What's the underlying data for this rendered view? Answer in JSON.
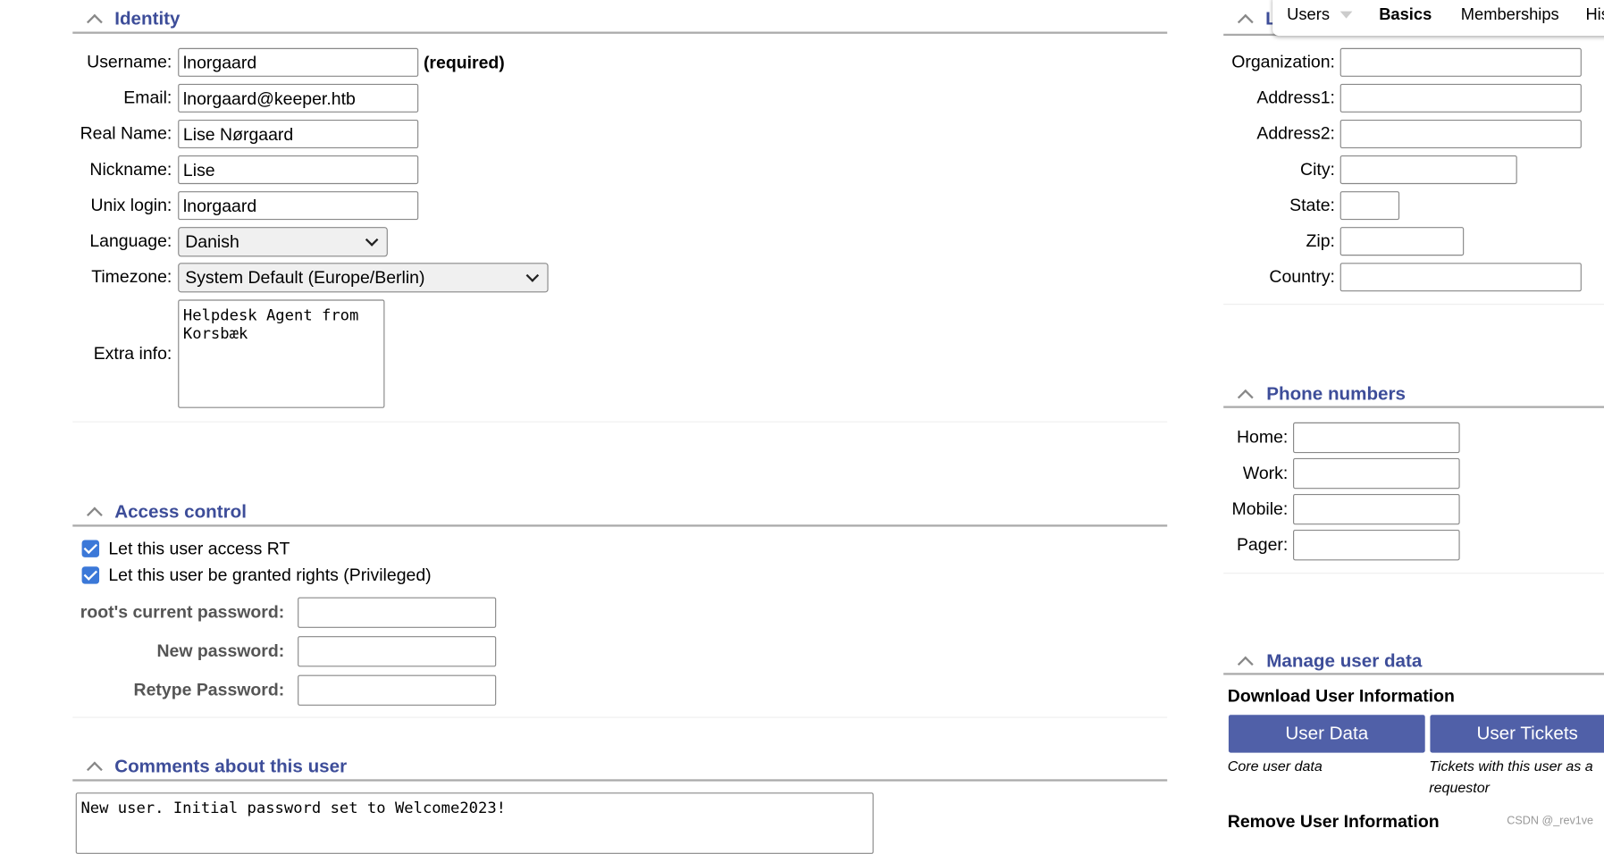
{
  "identity": {
    "title": "Identity",
    "fields": [
      {
        "label": "Username:",
        "value": "lnorgaard",
        "note": "(required)"
      },
      {
        "label": "Email:",
        "value": "lnorgaard@keeper.htb"
      },
      {
        "label": "Real Name:",
        "value": "Lise Nørgaard"
      },
      {
        "label": "Nickname:",
        "value": "Lise"
      },
      {
        "label": "Unix login:",
        "value": "lnorgaard"
      }
    ],
    "language": {
      "label": "Language:",
      "value": "Danish"
    },
    "timezone": {
      "label": "Timezone:",
      "value": "System Default (Europe/Berlin)"
    },
    "extra": {
      "label": "Extra info:",
      "value": "Helpdesk Agent from\nKorsbæk"
    }
  },
  "access": {
    "title": "Access control",
    "checks": [
      {
        "label": "Let this user access RT",
        "checked": true
      },
      {
        "label": "Let this user be granted rights (Privileged)",
        "checked": true
      }
    ],
    "passwords": [
      "root's current password:",
      "New password:",
      "Retype Password:"
    ]
  },
  "comments": {
    "title": "Comments about this user",
    "value": "New user. Initial password set to Welcome2023!"
  },
  "location": {
    "title": "L",
    "fields": [
      "Organization:",
      "Address1:",
      "Address2:",
      "City:",
      "State:",
      "Zip:",
      "Country:"
    ]
  },
  "phones": {
    "title": "Phone numbers",
    "fields": [
      "Home:",
      "Work:",
      "Mobile:",
      "Pager:"
    ]
  },
  "manage": {
    "title": "Manage user data",
    "download": "Download User Information",
    "btn1": "User Data",
    "btn2": "User Tickets",
    "desc1": "Core user data",
    "desc2": "Tickets with this user as a requestor",
    "remove": "Remove User Information"
  },
  "tabs": {
    "users": "Users",
    "basics": "Basics",
    "memberships": "Memberships",
    "history": "His"
  },
  "watermark": "CSDN @_rev1ve"
}
